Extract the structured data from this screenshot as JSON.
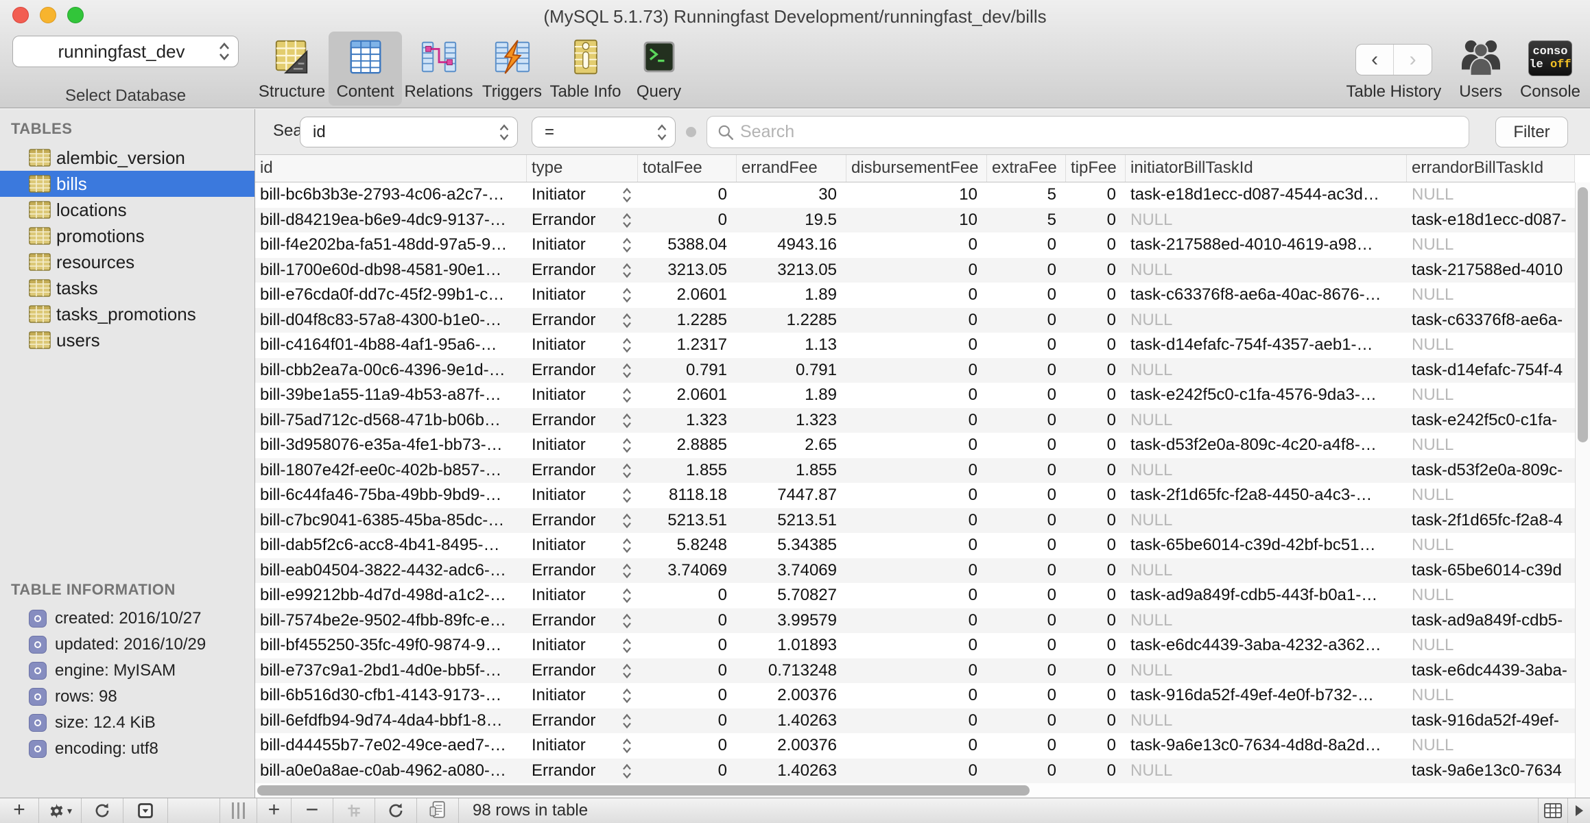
{
  "window": {
    "title": "(MySQL 5.1.73) Runningfast Development/runningfast_dev/bills"
  },
  "toolbar": {
    "database_selector": {
      "value": "runningfast_dev",
      "caption": "Select Database"
    },
    "nav_buttons": [
      {
        "label": "Structure",
        "icon": "structure-table-icon",
        "active": false
      },
      {
        "label": "Content",
        "icon": "content-table-icon",
        "active": true
      },
      {
        "label": "Relations",
        "icon": "relations-tables-icon",
        "active": false
      },
      {
        "label": "Triggers",
        "icon": "triggers-lightning-icon",
        "active": false
      },
      {
        "label": "Table Info",
        "icon": "table-info-icon",
        "active": false
      },
      {
        "label": "Query",
        "icon": "query-terminal-icon",
        "active": false
      }
    ],
    "table_history_label": "Table History",
    "users_label": "Users",
    "console_label": "Console",
    "console_badge": {
      "line1": "conso",
      "line2_white": "le",
      "line2_yellow": "off"
    }
  },
  "sidebar": {
    "tables_header": "TABLES",
    "selected_table": "bills",
    "tables": [
      "alembic_version",
      "bills",
      "locations",
      "promotions",
      "resources",
      "tasks",
      "tasks_promotions",
      "users"
    ],
    "info_header": "TABLE INFORMATION",
    "info_items": [
      "created: 2016/10/27",
      "updated: 2016/10/29",
      "engine: MyISAM",
      "rows: 98",
      "size: 12.4 KiB",
      "encoding: utf8"
    ]
  },
  "filter_bar": {
    "search_label": "Search:",
    "column_select": "id",
    "operator_select": "=",
    "search_placeholder": "Search",
    "filter_button": "Filter"
  },
  "table": {
    "columns": [
      "id",
      "type",
      "totalFee",
      "errandFee",
      "disbursementFee",
      "extraFee",
      "tipFee",
      "initiatorBillTaskId",
      "errandorBillTaskId"
    ],
    "rows": [
      [
        "bill-bc6b3b3e-2793-4c06-a2c7-…",
        "Initiator",
        "0",
        "30",
        "10",
        "5",
        "0",
        "task-e18d1ecc-d087-4544-ac3d…",
        "NULL"
      ],
      [
        "bill-d84219ea-b6e9-4dc9-9137-…",
        "Errandor",
        "0",
        "19.5",
        "10",
        "5",
        "0",
        "NULL",
        "task-e18d1ecc-d087-"
      ],
      [
        "bill-f4e202ba-fa51-48dd-97a5-9…",
        "Initiator",
        "5388.04",
        "4943.16",
        "0",
        "0",
        "0",
        "task-217588ed-4010-4619-a98…",
        "NULL"
      ],
      [
        "bill-1700e60d-db98-4581-90e1…",
        "Errandor",
        "3213.05",
        "3213.05",
        "0",
        "0",
        "0",
        "NULL",
        "task-217588ed-4010"
      ],
      [
        "bill-e76cda0f-dd7c-45f2-99b1-c…",
        "Initiator",
        "2.0601",
        "1.89",
        "0",
        "0",
        "0",
        "task-c63376f8-ae6a-40ac-8676-…",
        "NULL"
      ],
      [
        "bill-d04f8c83-57a8-4300-b1e0-…",
        "Errandor",
        "1.2285",
        "1.2285",
        "0",
        "0",
        "0",
        "NULL",
        "task-c63376f8-ae6a-"
      ],
      [
        "bill-c4164f01-4b88-4af1-95a6-…",
        "Initiator",
        "1.2317",
        "1.13",
        "0",
        "0",
        "0",
        "task-d14efafc-754f-4357-aeb1-…",
        "NULL"
      ],
      [
        "bill-cbb2ea7a-00c6-4396-9e1d-…",
        "Errandor",
        "0.791",
        "0.791",
        "0",
        "0",
        "0",
        "NULL",
        "task-d14efafc-754f-4"
      ],
      [
        "bill-39be1a55-11a9-4b53-a87f-…",
        "Initiator",
        "2.0601",
        "1.89",
        "0",
        "0",
        "0",
        "task-e242f5c0-c1fa-4576-9da3-…",
        "NULL"
      ],
      [
        "bill-75ad712c-d568-471b-b06b…",
        "Errandor",
        "1.323",
        "1.323",
        "0",
        "0",
        "0",
        "NULL",
        "task-e242f5c0-c1fa-"
      ],
      [
        "bill-3d958076-e35a-4fe1-bb73-…",
        "Initiator",
        "2.8885",
        "2.65",
        "0",
        "0",
        "0",
        "task-d53f2e0a-809c-4c20-a4f8-…",
        "NULL"
      ],
      [
        "bill-1807e42f-ee0c-402b-b857-…",
        "Errandor",
        "1.855",
        "1.855",
        "0",
        "0",
        "0",
        "NULL",
        "task-d53f2e0a-809c-"
      ],
      [
        "bill-6c44fa46-75ba-49bb-9bd9-…",
        "Initiator",
        "8118.18",
        "7447.87",
        "0",
        "0",
        "0",
        "task-2f1d65fc-f2a8-4450-a4c3-…",
        "NULL"
      ],
      [
        "bill-c7bc9041-6385-45ba-85dc-…",
        "Errandor",
        "5213.51",
        "5213.51",
        "0",
        "0",
        "0",
        "NULL",
        "task-2f1d65fc-f2a8-4"
      ],
      [
        "bill-dab5f2c6-acc8-4b41-8495-…",
        "Initiator",
        "5.8248",
        "5.34385",
        "0",
        "0",
        "0",
        "task-65be6014-c39d-42bf-bc51…",
        "NULL"
      ],
      [
        "bill-eab04504-3822-4432-adc6-…",
        "Errandor",
        "3.74069",
        "3.74069",
        "0",
        "0",
        "0",
        "NULL",
        "task-65be6014-c39d"
      ],
      [
        "bill-e99212bb-4d7d-498d-a1c2-…",
        "Initiator",
        "0",
        "5.70827",
        "0",
        "0",
        "0",
        "task-ad9a849f-cdb5-443f-b0a1-…",
        "NULL"
      ],
      [
        "bill-7574be2e-9502-4fbb-89fc-e…",
        "Errandor",
        "0",
        "3.99579",
        "0",
        "0",
        "0",
        "NULL",
        "task-ad9a849f-cdb5-"
      ],
      [
        "bill-bf455250-35fc-49f0-9874-9…",
        "Initiator",
        "0",
        "1.01893",
        "0",
        "0",
        "0",
        "task-e6dc4439-3aba-4232-a362…",
        "NULL"
      ],
      [
        "bill-e737c9a1-2bd1-4d0e-bb5f-…",
        "Errandor",
        "0",
        "0.713248",
        "0",
        "0",
        "0",
        "NULL",
        "task-e6dc4439-3aba-"
      ],
      [
        "bill-6b516d30-cfb1-4143-9173-…",
        "Initiator",
        "0",
        "2.00376",
        "0",
        "0",
        "0",
        "task-916da52f-49ef-4e0f-b732-…",
        "NULL"
      ],
      [
        "bill-6efdfb94-9d74-4da4-bbf1-8…",
        "Errandor",
        "0",
        "1.40263",
        "0",
        "0",
        "0",
        "NULL",
        "task-916da52f-49ef-"
      ],
      [
        "bill-d44455b7-7e02-49ce-aed7-…",
        "Initiator",
        "0",
        "2.00376",
        "0",
        "0",
        "0",
        "task-9a6e13c0-7634-4d8d-8a2d…",
        "NULL"
      ],
      [
        "bill-a0e0a8ae-c0ab-4962-a080-…",
        "Errandor",
        "0",
        "1.40263",
        "0",
        "0",
        "0",
        "NULL",
        "task-9a6e13c0-7634"
      ]
    ]
  },
  "status_bar": {
    "rows_text": "98 rows in table",
    "sidebar_buttons": [
      "add-table",
      "actions-gear",
      "refresh",
      "filter-view"
    ],
    "content_buttons": [
      "drag-handle",
      "add-row",
      "remove-row",
      "duplicate-row",
      "refresh",
      "edit-record"
    ],
    "right_buttons": [
      "table-view",
      "advance-arrow"
    ]
  },
  "colors": {
    "selection_blue": "#3b79dd",
    "table_icon_gold": "#dcc877",
    "null_text_gray": "#b8b8b8",
    "console_yellow": "#f3c125"
  }
}
